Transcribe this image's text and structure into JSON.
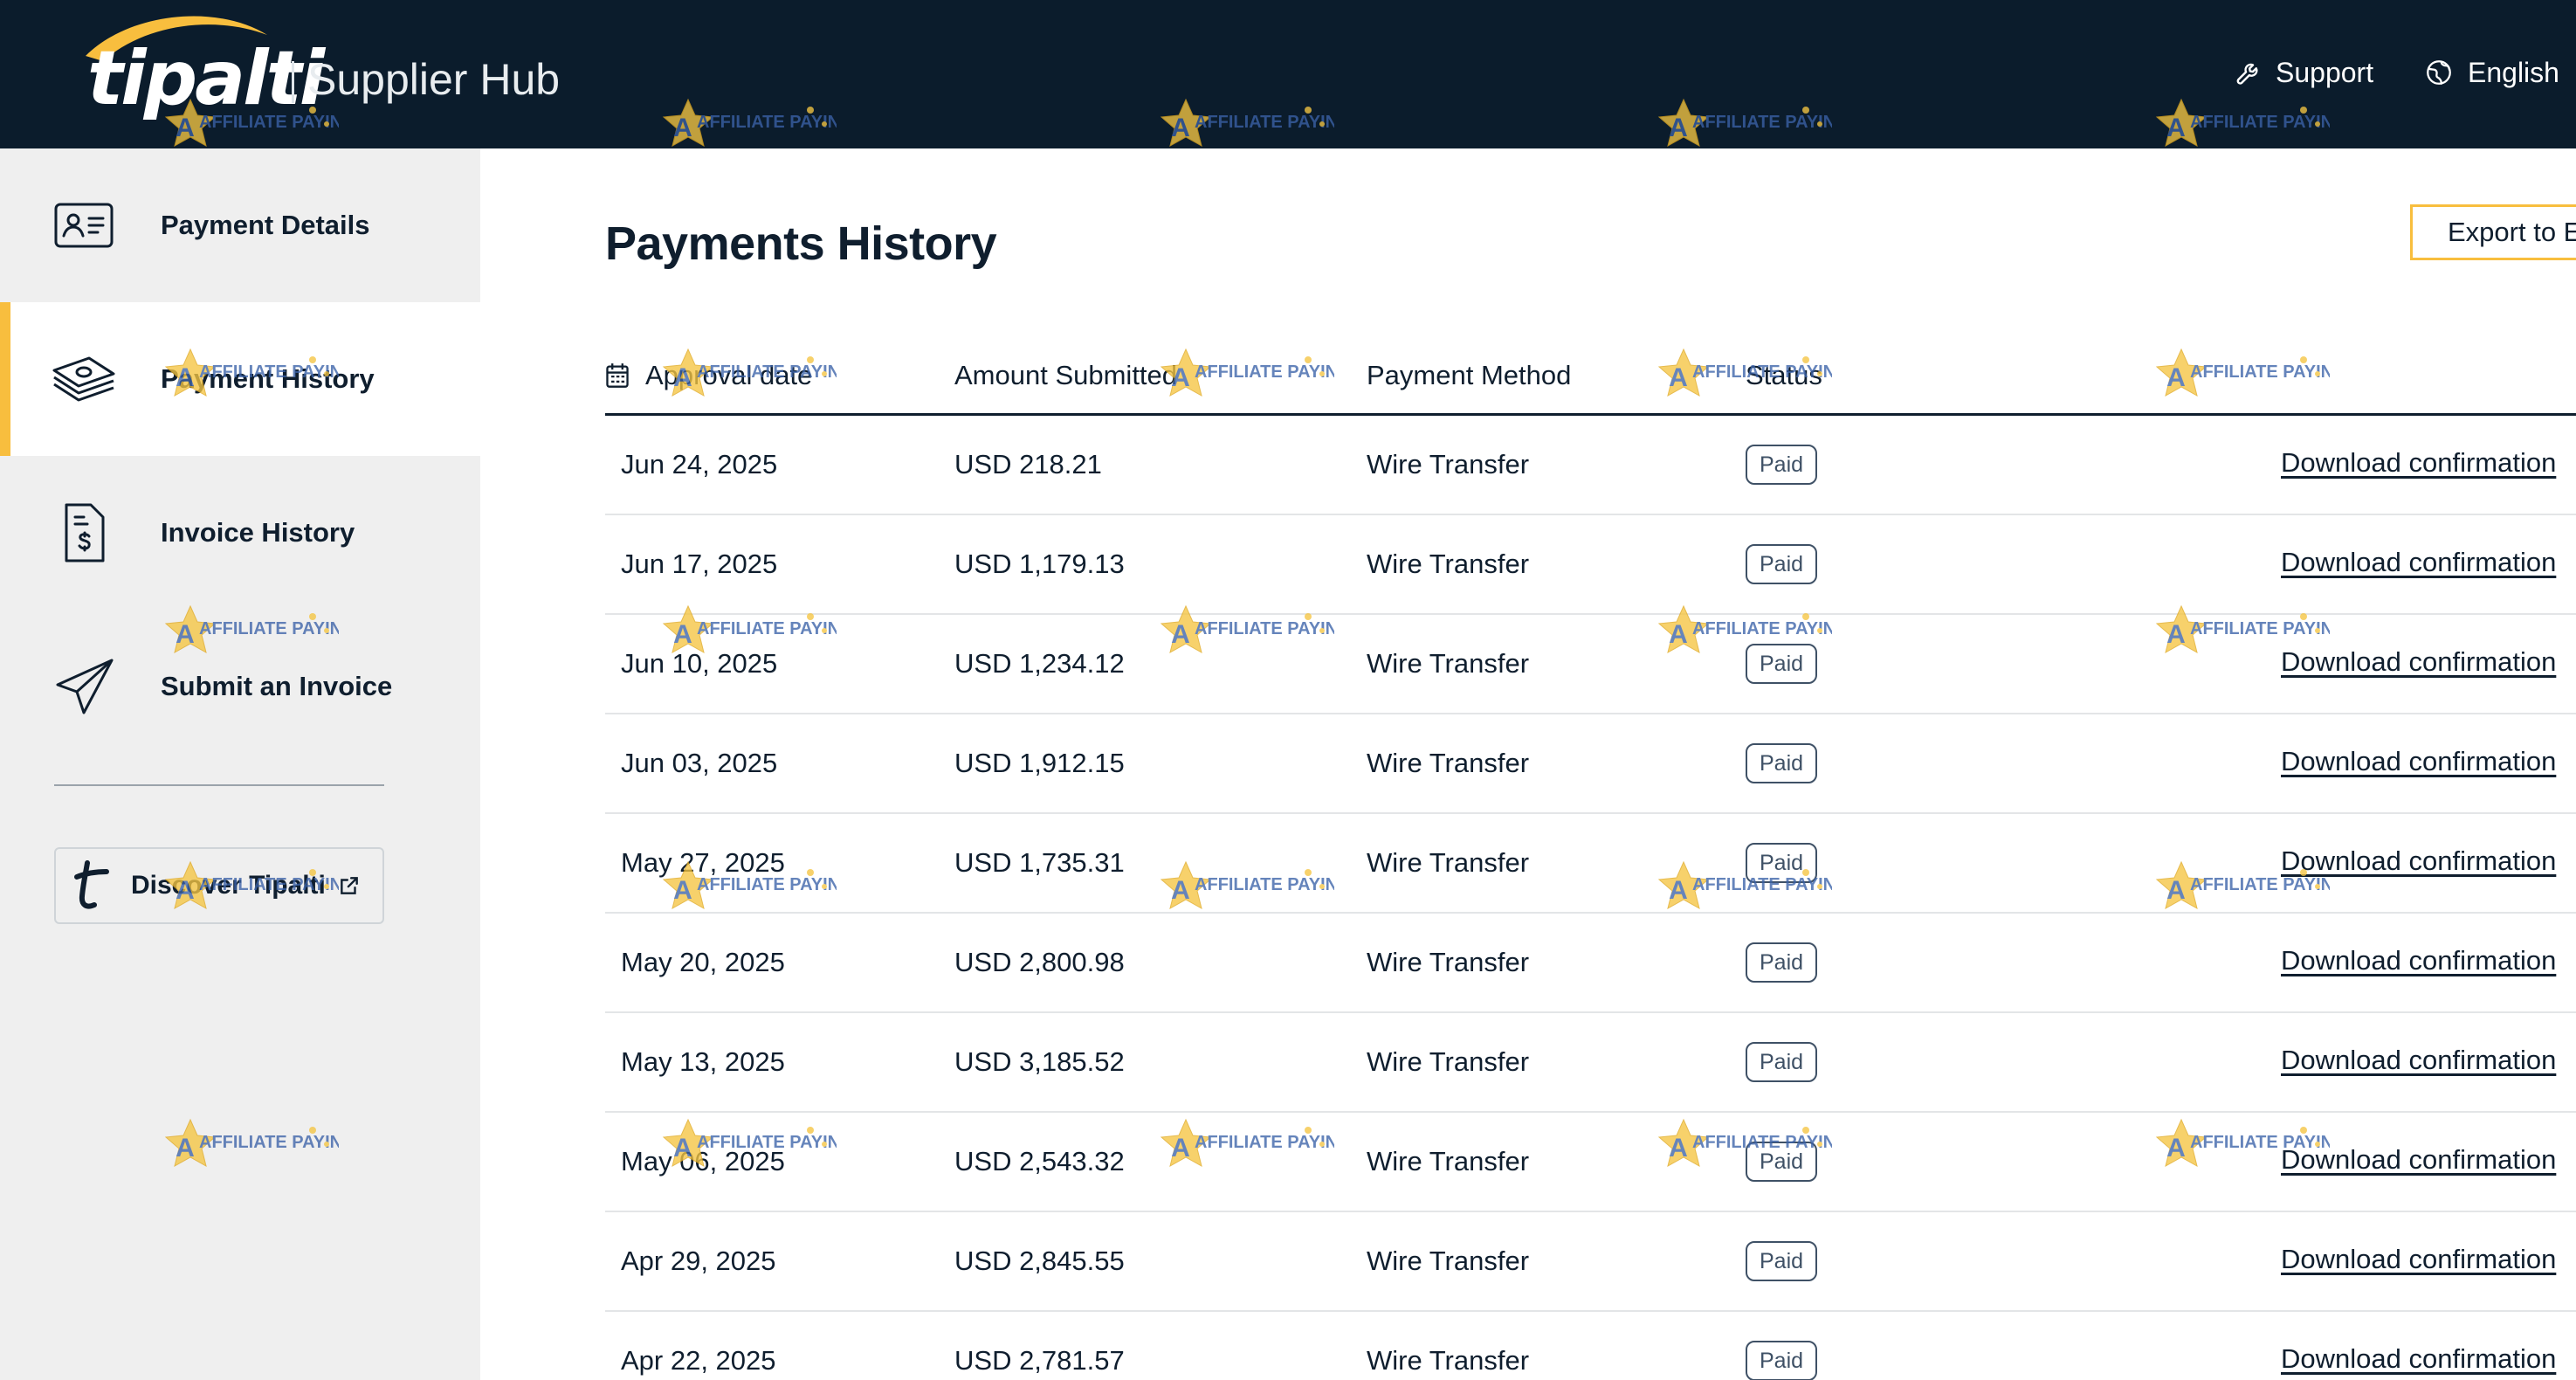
{
  "header": {
    "logo_text": "tipalti",
    "hub_title": "Supplier Hub",
    "support_label": "Support",
    "language_label": "English",
    "icons": {
      "support": "wrench-icon",
      "language": "globe-icon",
      "language_dropdown": "chevron-down-icon"
    }
  },
  "sidebar": {
    "items": [
      {
        "label": "Payment Details",
        "icon": "id-card-icon",
        "active": false
      },
      {
        "label": "Payment History",
        "icon": "money-stack-icon",
        "active": true
      },
      {
        "label": "Invoice History",
        "icon": "invoice-dollar-icon",
        "active": false
      },
      {
        "label": "Submit an Invoice",
        "icon": "paper-plane-icon",
        "active": false
      }
    ],
    "discover_label": "Discover Tipalti",
    "discover_icons": [
      "tipalti-t-icon",
      "external-link-icon"
    ]
  },
  "main": {
    "title": "Payments History",
    "export_label": "Export to E",
    "columns": [
      "Approval date",
      "Amount Submitted",
      "Payment Method",
      "Status"
    ],
    "rows": [
      {
        "date": "Jun 24, 2025",
        "amount": "USD 218.21",
        "method": "Wire Transfer",
        "status": "Paid",
        "action": "Download confirmation"
      },
      {
        "date": "Jun 17, 2025",
        "amount": "USD 1,179.13",
        "method": "Wire Transfer",
        "status": "Paid",
        "action": "Download confirmation"
      },
      {
        "date": "Jun 10, 2025",
        "amount": "USD 1,234.12",
        "method": "Wire Transfer",
        "status": "Paid",
        "action": "Download confirmation"
      },
      {
        "date": "Jun 03, 2025",
        "amount": "USD 1,912.15",
        "method": "Wire Transfer",
        "status": "Paid",
        "action": "Download confirmation"
      },
      {
        "date": "May 27, 2025",
        "amount": "USD 1,735.31",
        "method": "Wire Transfer",
        "status": "Paid",
        "action": "Download confirmation"
      },
      {
        "date": "May 20, 2025",
        "amount": "USD 2,800.98",
        "method": "Wire Transfer",
        "status": "Paid",
        "action": "Download confirmation"
      },
      {
        "date": "May 13, 2025",
        "amount": "USD 3,185.52",
        "method": "Wire Transfer",
        "status": "Paid",
        "action": "Download confirmation"
      },
      {
        "date": "May 06, 2025",
        "amount": "USD 2,543.32",
        "method": "Wire Transfer",
        "status": "Paid",
        "action": "Download confirmation"
      },
      {
        "date": "Apr 29, 2025",
        "amount": "USD 2,845.55",
        "method": "Wire Transfer",
        "status": "Paid",
        "action": "Download confirmation"
      },
      {
        "date": "Apr 22, 2025",
        "amount": "USD 2,781.57",
        "method": "Wire Transfer",
        "status": "Paid",
        "action": "Download confirmation"
      }
    ]
  },
  "watermark": {
    "text": "AFFILIATE PAYING"
  },
  "colors": {
    "header_bg": "#0b1c2c",
    "accent": "#f8be3e",
    "sidebar_bg": "#efefef",
    "text": "#0f1e2e",
    "badge": "#3f5166"
  }
}
